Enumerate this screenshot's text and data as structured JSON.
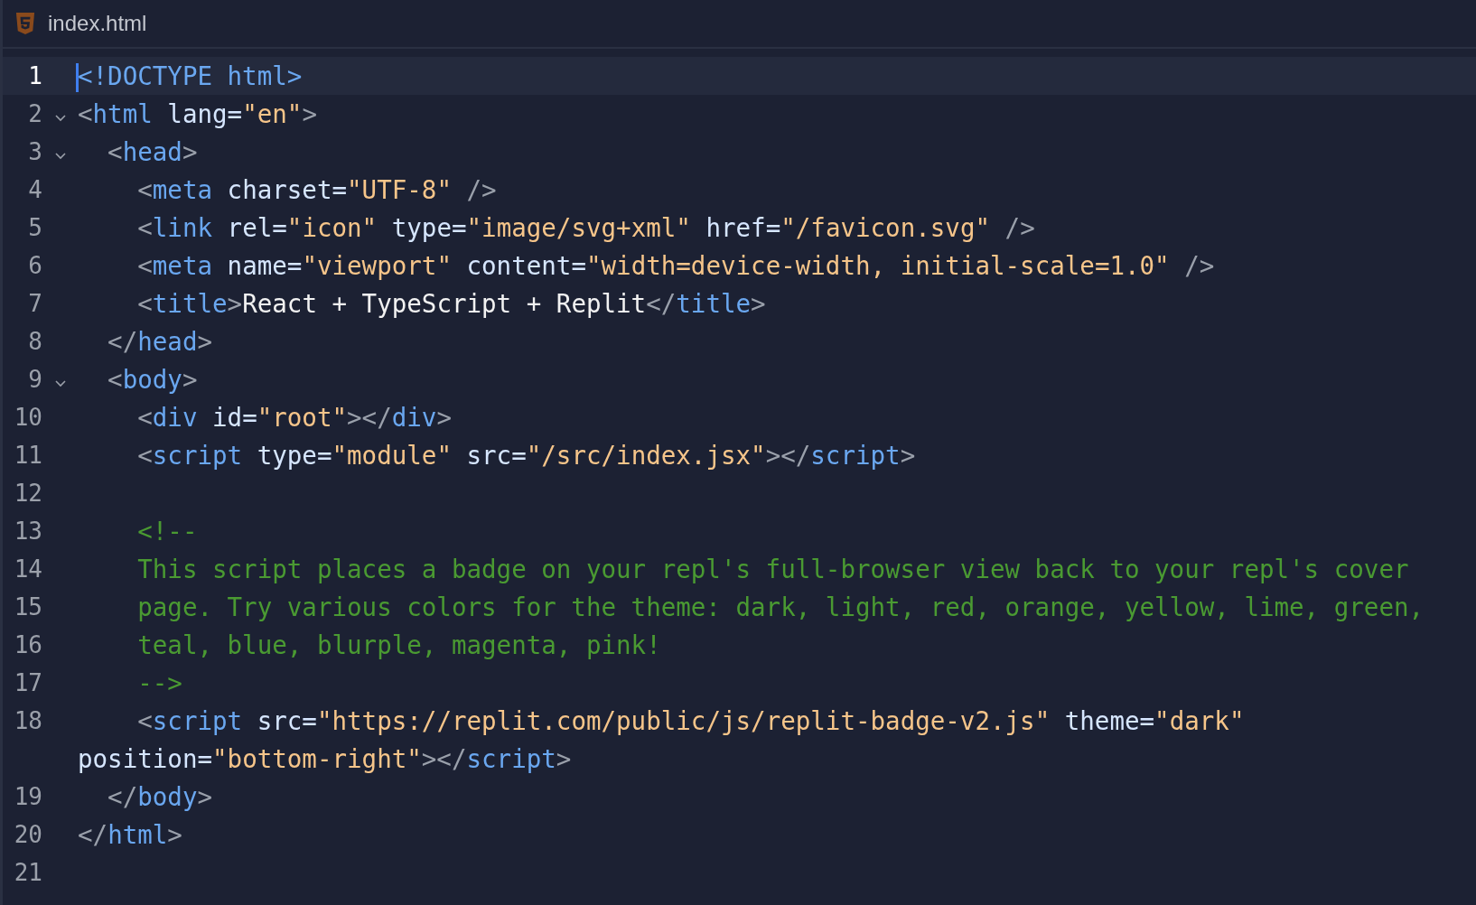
{
  "tab": {
    "title": "index.html"
  },
  "lines": [
    {
      "number": "1",
      "active": true,
      "fold": false,
      "tokens": [
        {
          "kind": "tag",
          "text": "<!DOCTYPE html>"
        }
      ]
    },
    {
      "number": "2",
      "active": false,
      "fold": true,
      "tokens": [
        {
          "kind": "punct",
          "text": "<"
        },
        {
          "kind": "tag",
          "text": "html"
        },
        {
          "kind": "attr",
          "text": " lang="
        },
        {
          "kind": "string",
          "text": "\"en\""
        },
        {
          "kind": "punct",
          "text": ">"
        }
      ]
    },
    {
      "number": "3",
      "active": false,
      "fold": true,
      "tokens": [
        {
          "kind": "punct",
          "text": "  <"
        },
        {
          "kind": "tag",
          "text": "head"
        },
        {
          "kind": "punct",
          "text": ">"
        }
      ]
    },
    {
      "number": "4",
      "active": false,
      "fold": false,
      "tokens": [
        {
          "kind": "punct",
          "text": "    <"
        },
        {
          "kind": "tag",
          "text": "meta"
        },
        {
          "kind": "attr",
          "text": " charset="
        },
        {
          "kind": "string",
          "text": "\"UTF-8\""
        },
        {
          "kind": "punct",
          "text": " />"
        }
      ]
    },
    {
      "number": "5",
      "active": false,
      "fold": false,
      "tokens": [
        {
          "kind": "punct",
          "text": "    <"
        },
        {
          "kind": "tag",
          "text": "link"
        },
        {
          "kind": "attr",
          "text": " rel="
        },
        {
          "kind": "string",
          "text": "\"icon\""
        },
        {
          "kind": "attr",
          "text": " type="
        },
        {
          "kind": "string",
          "text": "\"image/svg+xml\""
        },
        {
          "kind": "attr",
          "text": " href="
        },
        {
          "kind": "string",
          "text": "\"/favicon.svg\""
        },
        {
          "kind": "punct",
          "text": " />"
        }
      ]
    },
    {
      "number": "6",
      "active": false,
      "fold": false,
      "tokens": [
        {
          "kind": "punct",
          "text": "    <"
        },
        {
          "kind": "tag",
          "text": "meta"
        },
        {
          "kind": "attr",
          "text": " name="
        },
        {
          "kind": "string",
          "text": "\"viewport\""
        },
        {
          "kind": "attr",
          "text": " content="
        },
        {
          "kind": "string",
          "text": "\"width=device-width, initial-scale=1.0\""
        },
        {
          "kind": "punct",
          "text": " />"
        }
      ]
    },
    {
      "number": "7",
      "active": false,
      "fold": false,
      "tokens": [
        {
          "kind": "punct",
          "text": "    <"
        },
        {
          "kind": "tag",
          "text": "title"
        },
        {
          "kind": "punct",
          "text": ">"
        },
        {
          "kind": "text",
          "text": "React + TypeScript + Replit"
        },
        {
          "kind": "punct",
          "text": "</"
        },
        {
          "kind": "tag",
          "text": "title"
        },
        {
          "kind": "punct",
          "text": ">"
        }
      ]
    },
    {
      "number": "8",
      "active": false,
      "fold": false,
      "tokens": [
        {
          "kind": "punct",
          "text": "  </"
        },
        {
          "kind": "tag",
          "text": "head"
        },
        {
          "kind": "punct",
          "text": ">"
        }
      ]
    },
    {
      "number": "9",
      "active": false,
      "fold": true,
      "tokens": [
        {
          "kind": "punct",
          "text": "  <"
        },
        {
          "kind": "tag",
          "text": "body"
        },
        {
          "kind": "punct",
          "text": ">"
        }
      ]
    },
    {
      "number": "10",
      "active": false,
      "fold": false,
      "tokens": [
        {
          "kind": "punct",
          "text": "    <"
        },
        {
          "kind": "tag",
          "text": "div"
        },
        {
          "kind": "attr",
          "text": " id="
        },
        {
          "kind": "string",
          "text": "\"root\""
        },
        {
          "kind": "punct",
          "text": "></"
        },
        {
          "kind": "tag",
          "text": "div"
        },
        {
          "kind": "punct",
          "text": ">"
        }
      ]
    },
    {
      "number": "11",
      "active": false,
      "fold": false,
      "tokens": [
        {
          "kind": "punct",
          "text": "    <"
        },
        {
          "kind": "tag",
          "text": "script"
        },
        {
          "kind": "attr",
          "text": " type="
        },
        {
          "kind": "string",
          "text": "\"module\""
        },
        {
          "kind": "attr",
          "text": " src="
        },
        {
          "kind": "string",
          "text": "\"/src/index.jsx\""
        },
        {
          "kind": "punct",
          "text": "></"
        },
        {
          "kind": "tag",
          "text": "script"
        },
        {
          "kind": "punct",
          "text": ">"
        }
      ]
    },
    {
      "number": "12",
      "active": false,
      "fold": false
    },
    {
      "number": "13",
      "active": false,
      "fold": false,
      "tokens": [
        {
          "kind": "comment",
          "text": "    <!--"
        }
      ]
    },
    {
      "number": "14",
      "active": false,
      "fold": false,
      "tokens": [
        {
          "kind": "comment",
          "text": "    This script places a badge on your repl's full-browser view back to your repl's cover"
        }
      ]
    },
    {
      "number": "15",
      "active": false,
      "fold": false,
      "tokens": [
        {
          "kind": "comment",
          "text": "    page. Try various colors for the theme: dark, light, red, orange, yellow, lime, green,"
        }
      ]
    },
    {
      "number": "16",
      "active": false,
      "fold": false,
      "tokens": [
        {
          "kind": "comment",
          "text": "    teal, blue, blurple, magenta, pink!"
        }
      ]
    },
    {
      "number": "17",
      "active": false,
      "fold": false,
      "tokens": [
        {
          "kind": "comment",
          "text": "    -->"
        }
      ]
    },
    {
      "number": "18",
      "active": false,
      "fold": false,
      "tokens": [
        {
          "kind": "punct",
          "text": "    <"
        },
        {
          "kind": "tag",
          "text": "script"
        },
        {
          "kind": "attr",
          "text": " src="
        },
        {
          "kind": "string",
          "text": "\"https://replit.com/public/js/replit-badge-v2.js\""
        },
        {
          "kind": "attr",
          "text": " theme="
        },
        {
          "kind": "string",
          "text": "\"dark\""
        }
      ],
      "wrap": [
        {
          "kind": "attr",
          "text": "position="
        },
        {
          "kind": "string",
          "text": "\"bottom-right\""
        },
        {
          "kind": "punct",
          "text": "></"
        },
        {
          "kind": "tag",
          "text": "script"
        },
        {
          "kind": "punct",
          "text": ">"
        }
      ]
    },
    {
      "number": "19",
      "active": false,
      "fold": false,
      "tokens": [
        {
          "kind": "punct",
          "text": "  </"
        },
        {
          "kind": "tag",
          "text": "body"
        },
        {
          "kind": "punct",
          "text": ">"
        }
      ]
    },
    {
      "number": "20",
      "active": false,
      "fold": false,
      "tokens": [
        {
          "kind": "punct",
          "text": "</"
        },
        {
          "kind": "tag",
          "text": "html"
        },
        {
          "kind": "punct",
          "text": ">"
        }
      ]
    },
    {
      "number": "21",
      "active": false,
      "fold": false
    }
  ]
}
